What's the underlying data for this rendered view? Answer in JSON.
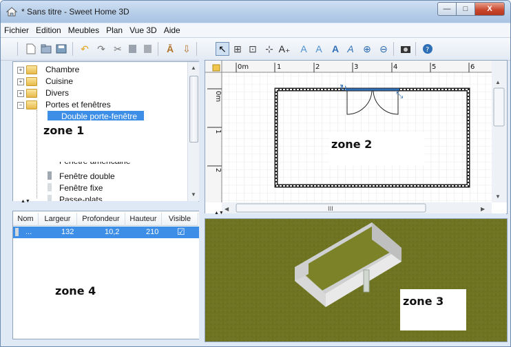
{
  "window": {
    "title": "* Sans titre - Sweet Home 3D"
  },
  "window_buttons": {
    "minimize": "—",
    "maximize": "□",
    "close": "X"
  },
  "menu": [
    "Fichier",
    "Edition",
    "Meubles",
    "Plan",
    "Vue 3D",
    "Aide"
  ],
  "toolbar_icons": [
    "new-icon",
    "open-icon",
    "save-icon",
    "undo-icon",
    "redo-icon",
    "cut-icon",
    "copy-icon",
    "paste-icon",
    "add-furniture-icon",
    "import-furniture-icon",
    "select-icon",
    "create-walls-icon",
    "create-rooms-icon",
    "create-dimensions-icon",
    "add-text-icon",
    "text-style-icon",
    "text-style-icon",
    "bold-icon",
    "italic-icon",
    "zoom-in-icon",
    "zoom-out-icon",
    "photo-icon",
    "help-icon"
  ],
  "catalog": {
    "categories": [
      "Chambre",
      "Cuisine",
      "Divers",
      "Portes et fenêtres"
    ],
    "expanded_items": [
      "Double porte-fenêtre",
      "Fenêtre américaine",
      "Fenêtre double",
      "Fenêtre fixe",
      "Passe-plats"
    ],
    "selected": "Double porte-fenêtre"
  },
  "furniture_table": {
    "columns": [
      "Nom",
      "Largeur",
      "Profondeur",
      "Hauteur",
      "Visible"
    ],
    "row": {
      "name": "...",
      "width": "132",
      "depth": "10,2",
      "height": "210",
      "visible": "☑"
    }
  },
  "plan": {
    "ruler_x": [
      "0m",
      "1",
      "2",
      "3",
      "4",
      "5",
      "6"
    ],
    "ruler_y": [
      "0m",
      "1",
      "2"
    ],
    "scroll_label": "III"
  },
  "zones": {
    "zone1": "zone 1",
    "zone2": "zone 2",
    "zone3": "zone 3",
    "zone4": "zone 4"
  },
  "colors": {
    "ground": "#6e7421",
    "selection": "#3d8ee6",
    "wall_fill": "#d9d9d9"
  }
}
